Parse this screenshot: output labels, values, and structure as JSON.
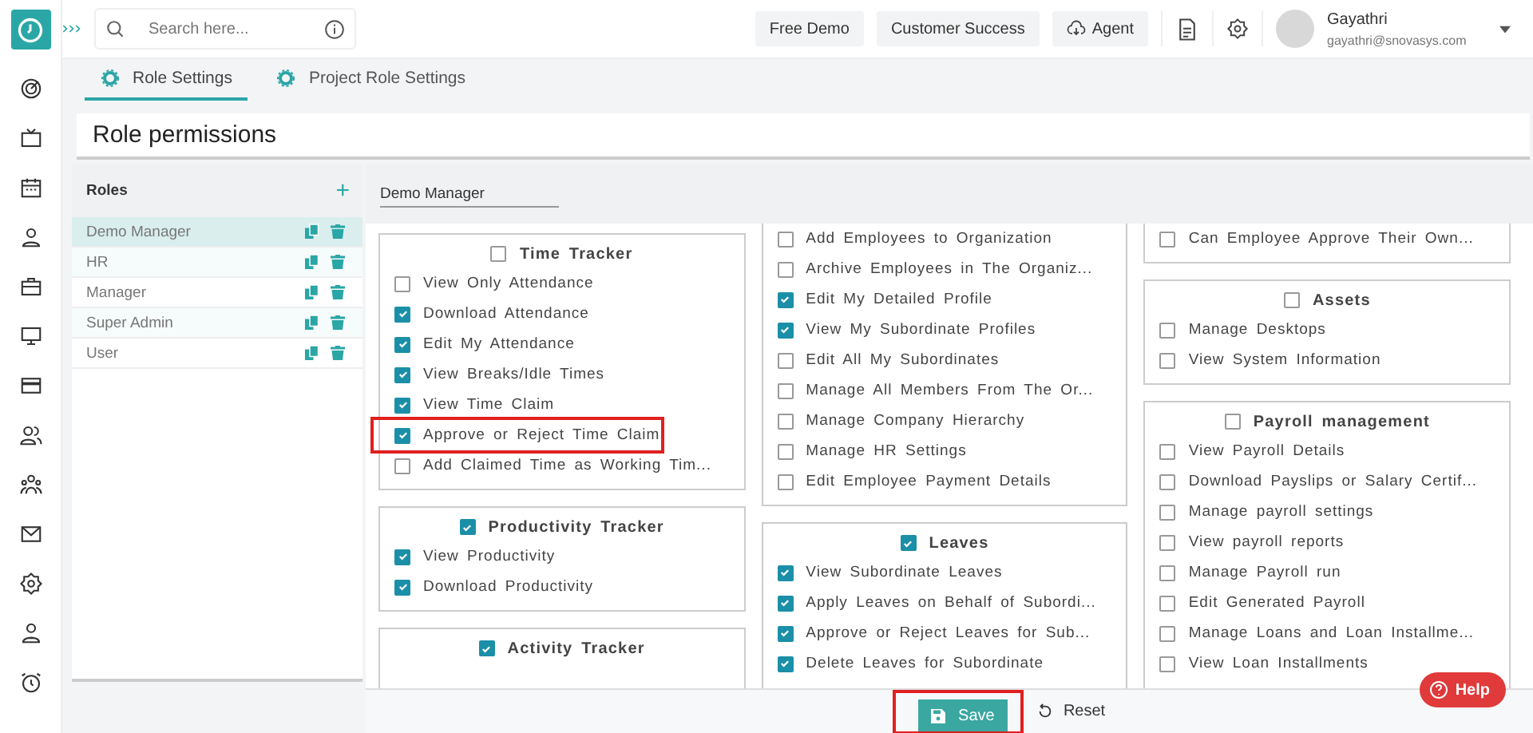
{
  "header": {
    "search": {
      "placeholder": "Search here..."
    },
    "buttons": [
      {
        "label": "Free Demo",
        "kind": "plain"
      },
      {
        "label": "Customer Success",
        "kind": "plain"
      },
      {
        "label": "Agent",
        "kind": "cloud"
      }
    ],
    "user": {
      "name": "Gayathri",
      "email": "gayathri@snovasys.com"
    }
  },
  "tabs": [
    {
      "label": "Role Settings",
      "selected": true
    },
    {
      "label": "Project Role Settings",
      "selected": false
    }
  ],
  "page_title": "Role permissions",
  "roles": {
    "title": "Roles",
    "add": "+",
    "items": [
      {
        "name": "Demo Manager",
        "selected": true
      },
      {
        "name": "HR",
        "selected": false
      },
      {
        "name": "Manager",
        "selected": false
      },
      {
        "name": "Super Admin",
        "selected": false
      },
      {
        "name": "User",
        "selected": false
      }
    ]
  },
  "role_name": "Demo Manager",
  "columns": [
    [
      {
        "title": "Time Tracker",
        "checked": false,
        "items": [
          {
            "label": "View Only Attendance",
            "checked": false,
            "highlighted": false
          },
          {
            "label": "Download Attendance",
            "checked": true,
            "highlighted": false
          },
          {
            "label": "Edit My Attendance",
            "checked": true,
            "highlighted": false
          },
          {
            "label": "View Breaks/Idle Times",
            "checked": true,
            "highlighted": false
          },
          {
            "label": "View Time Claim",
            "checked": true,
            "highlighted": false
          },
          {
            "label": "Approve or Reject Time Claim",
            "checked": true,
            "highlighted": true
          },
          {
            "label": "Add Claimed Time as Working Tim...",
            "checked": false,
            "highlighted": false
          }
        ]
      },
      {
        "title": "Productivity Tracker",
        "checked": true,
        "items": [
          {
            "label": "View Productivity",
            "checked": true,
            "highlighted": false
          },
          {
            "label": "Download Productivity",
            "checked": true,
            "highlighted": false
          }
        ]
      },
      {
        "title": "Activity Tracker",
        "checked": true
      }
    ],
    [
      {
        "items": [
          {
            "label": "Add Employees to Organization",
            "checked": false,
            "highlighted": false
          },
          {
            "label": "Archive Employees in The Organiz...",
            "checked": false,
            "highlighted": false
          },
          {
            "label": "Edit My Detailed Profile",
            "checked": true,
            "highlighted": false
          },
          {
            "label": "View My Subordinate Profiles",
            "checked": true,
            "highlighted": false
          },
          {
            "label": "Edit All My Subordinates",
            "checked": false,
            "highlighted": false
          },
          {
            "label": "Manage All Members From The Or...",
            "checked": false,
            "highlighted": false
          },
          {
            "label": "Manage Company Hierarchy",
            "checked": false,
            "highlighted": false
          },
          {
            "label": "Manage HR Settings",
            "checked": false,
            "highlighted": false
          },
          {
            "label": "Edit Employee Payment Details",
            "checked": false,
            "highlighted": false
          }
        ]
      },
      {
        "title": "Leaves",
        "checked": true,
        "items": [
          {
            "label": "View Subordinate Leaves",
            "checked": true,
            "highlighted": false
          },
          {
            "label": "Apply Leaves on Behalf of Subordi...",
            "checked": true,
            "highlighted": false
          },
          {
            "label": "Approve or Reject Leaves for Sub...",
            "checked": true,
            "highlighted": false
          },
          {
            "label": "Delete Leaves for Subordinate",
            "checked": true,
            "highlighted": false
          }
        ]
      }
    ],
    [
      {
        "items": [
          {
            "label": "Can Employee Approve Their Own...",
            "checked": false,
            "highlighted": false
          }
        ]
      },
      {
        "title": "Assets",
        "checked": false,
        "items": [
          {
            "label": "Manage Desktops",
            "checked": false,
            "highlighted": false
          },
          {
            "label": "View System Information",
            "checked": false,
            "highlighted": false
          }
        ]
      },
      {
        "title": "Payroll management",
        "checked": false,
        "items": [
          {
            "label": "View Payroll Details",
            "checked": false,
            "highlighted": false
          },
          {
            "label": "Download Payslips or Salary Certif...",
            "checked": false,
            "highlighted": false
          },
          {
            "label": "Manage payroll settings",
            "checked": false,
            "highlighted": false
          },
          {
            "label": "View payroll reports",
            "checked": false,
            "highlighted": false
          },
          {
            "label": "Manage Payroll run",
            "checked": false,
            "highlighted": false
          },
          {
            "label": "Edit Generated Payroll",
            "checked": false,
            "highlighted": false
          },
          {
            "label": "Manage Loans and Loan Installme...",
            "checked": false,
            "highlighted": false
          },
          {
            "label": "View Loan Installments",
            "checked": false,
            "highlighted": false
          }
        ]
      }
    ]
  ],
  "footer": {
    "save": {
      "label": "Save",
      "highlighted": true
    },
    "reset": "Reset"
  },
  "help": "Help"
}
